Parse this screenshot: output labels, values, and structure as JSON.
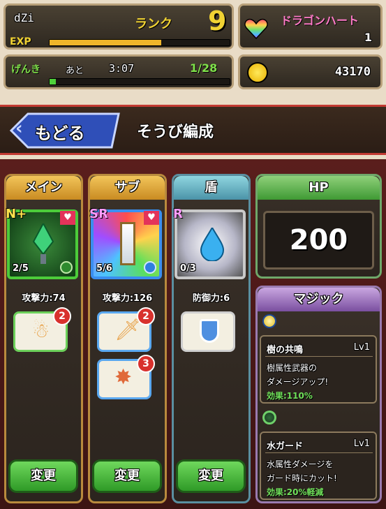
{
  "player": {
    "name": "dZi",
    "rank_label": "ランク",
    "rank": "9",
    "exp_label": "EXP",
    "exp_fill": 0.62
  },
  "stamina": {
    "label": "げんき",
    "time_prefix": "あと",
    "timer": "3:07",
    "value": "1/28",
    "fill": 0.036
  },
  "dragon_heart": {
    "label": "ドラゴンハート",
    "count": "1"
  },
  "gold": {
    "amount": "43170"
  },
  "header": {
    "back_label": "もどる",
    "title": "そうび編成"
  },
  "columns": [
    {
      "label": "メイン",
      "rarity": "N+",
      "count": "2/5",
      "stat": "攻撃力:74",
      "skill_badge": "2",
      "change": "変更"
    },
    {
      "label": "サブ",
      "rarity": "SR",
      "count": "5/6",
      "stat": "攻撃力:126",
      "skill_badges": [
        "2",
        "3"
      ],
      "change": "変更"
    },
    {
      "label": "盾",
      "rarity": "R",
      "count": "0/3",
      "stat": "防御力:6",
      "change": "変更"
    }
  ],
  "hp": {
    "label": "HP",
    "value": "200"
  },
  "magic": {
    "label": "マジック",
    "items": [
      {
        "name": "樹の共鳴",
        "level": "Lv1",
        "desc1": "樹属性武器の",
        "desc2": "ダメージアップ!",
        "effect": "効果:110%"
      },
      {
        "name": "水ガード",
        "level": "Lv1",
        "desc1": "水属性ダメージを",
        "desc2": "ガード時にカット!",
        "effect": "効果:20%軽減"
      }
    ]
  },
  "colors": {
    "accent_gold": "#f0d233",
    "banner_red": "#c23a33",
    "button_green": "#3aae2e"
  }
}
